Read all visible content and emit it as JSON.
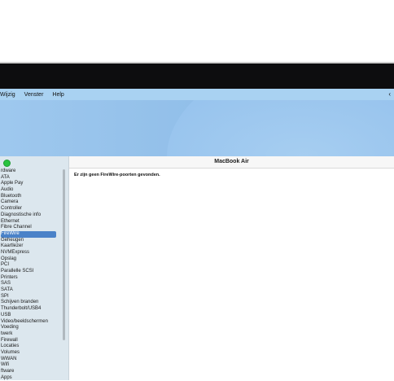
{
  "menubar": {
    "items": [
      "Wijzig",
      "Venster",
      "Help"
    ],
    "right_icon": "chevron-left-icon"
  },
  "window": {
    "title": "MacBook Air",
    "message": "Er zijn geen FireWire-poorten gevonden.",
    "traffic_light_color": "#29c33f"
  },
  "sidebar": {
    "items": [
      {
        "label": "rdware",
        "selected": false
      },
      {
        "label": "ATA",
        "selected": false
      },
      {
        "label": "Apple Pay",
        "selected": false
      },
      {
        "label": "Audio",
        "selected": false
      },
      {
        "label": "Bluetooth",
        "selected": false
      },
      {
        "label": "Camera",
        "selected": false
      },
      {
        "label": "Controller",
        "selected": false
      },
      {
        "label": "Diagnostische info",
        "selected": false
      },
      {
        "label": "Ethernet",
        "selected": false
      },
      {
        "label": "Fibre Channel",
        "selected": false
      },
      {
        "label": "FireWire",
        "selected": true
      },
      {
        "label": "Geheugen",
        "selected": false
      },
      {
        "label": "Kaartlezer",
        "selected": false
      },
      {
        "label": "NVMExpress",
        "selected": false
      },
      {
        "label": "Opslag",
        "selected": false
      },
      {
        "label": "PCI",
        "selected": false
      },
      {
        "label": "Parallelle SCSI",
        "selected": false
      },
      {
        "label": "Printers",
        "selected": false
      },
      {
        "label": "SAS",
        "selected": false
      },
      {
        "label": "SATA",
        "selected": false
      },
      {
        "label": "SPI",
        "selected": false
      },
      {
        "label": "Schijven branden",
        "selected": false
      },
      {
        "label": "Thunderbolt/USB4",
        "selected": false
      },
      {
        "label": "USB",
        "selected": false
      },
      {
        "label": "Video/beeldschermen",
        "selected": false
      },
      {
        "label": "Voeding",
        "selected": false
      },
      {
        "label": "twerk",
        "selected": false
      },
      {
        "label": "Firewall",
        "selected": false
      },
      {
        "label": "Locaties",
        "selected": false
      },
      {
        "label": "Volumes",
        "selected": false
      },
      {
        "label": "WWAN",
        "selected": false
      },
      {
        "label": "Wifi",
        "selected": false
      },
      {
        "label": "ftware",
        "selected": false
      },
      {
        "label": "Apps",
        "selected": false
      }
    ]
  },
  "colors": {
    "selection": "#4a82c8",
    "menubar": "#a9d2f2",
    "sidebar_bg": "#dce7ee"
  }
}
